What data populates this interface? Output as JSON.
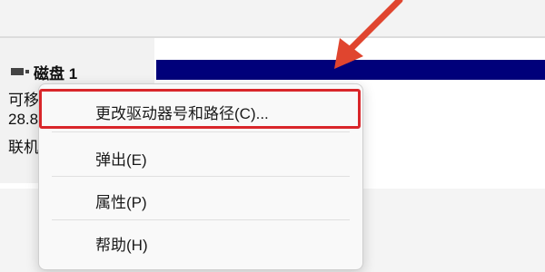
{
  "disk": {
    "name": "磁盘 1",
    "type_label": "可移",
    "size_label": "28.8",
    "status_label": "联机"
  },
  "context_menu": {
    "items": [
      {
        "label": "更改驱动器号和路径(C)..."
      },
      {
        "label": "弹出(E)"
      },
      {
        "label": "属性(P)"
      },
      {
        "label": "帮助(H)"
      }
    ]
  },
  "colors": {
    "partition_bar": "#00007a",
    "highlight": "#d9262a",
    "arrow": "#e0452f"
  }
}
